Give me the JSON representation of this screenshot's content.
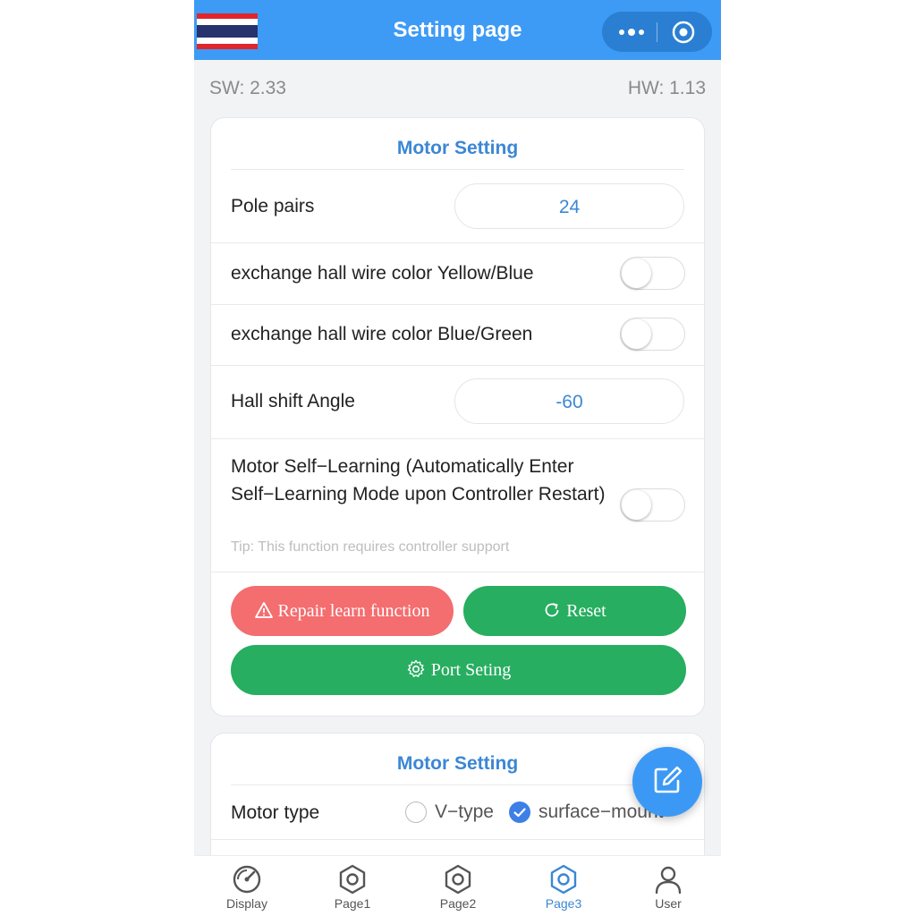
{
  "header": {
    "title": "Setting page"
  },
  "versions": {
    "sw": "SW: 2.33",
    "hw": "HW: 1.13"
  },
  "motor_card": {
    "title": "Motor Setting",
    "pole_pairs": {
      "label": "Pole pairs",
      "value": "24"
    },
    "hall_yellow_blue": {
      "label": "exchange hall wire color Yellow/Blue",
      "enabled": false
    },
    "hall_blue_green": {
      "label": "exchange hall wire color Blue/Green",
      "enabled": false
    },
    "hall_shift": {
      "label": "Hall shift Angle",
      "value": "-60"
    },
    "self_learning": {
      "label": "Motor Self−Learning (Automatically Enter Self−Learning Mode upon Controller Restart)",
      "tip": "Tip: This function requires controller support",
      "enabled": false
    },
    "buttons": {
      "repair": "Repair learn function",
      "reset": "Reset",
      "port": "Port Seting"
    }
  },
  "motor_card2": {
    "title": "Motor Setting",
    "motor_type": {
      "label": "Motor type",
      "options": [
        "V−type",
        "surface−mount"
      ],
      "selected": "surface−mount"
    }
  },
  "tabs": [
    {
      "label": "Display",
      "icon": "speedometer-icon"
    },
    {
      "label": "Page1",
      "icon": "hexagon-nut-icon"
    },
    {
      "label": "Page2",
      "icon": "hexagon-nut-icon"
    },
    {
      "label": "Page3",
      "icon": "hexagon-nut-icon",
      "active": true
    },
    {
      "label": "User",
      "icon": "user-icon"
    }
  ],
  "colors": {
    "nav": "#3d9bf5",
    "accent": "#3b87d4",
    "danger": "#f46d6f",
    "success": "#27ae60",
    "fab": "#3b99f5"
  }
}
